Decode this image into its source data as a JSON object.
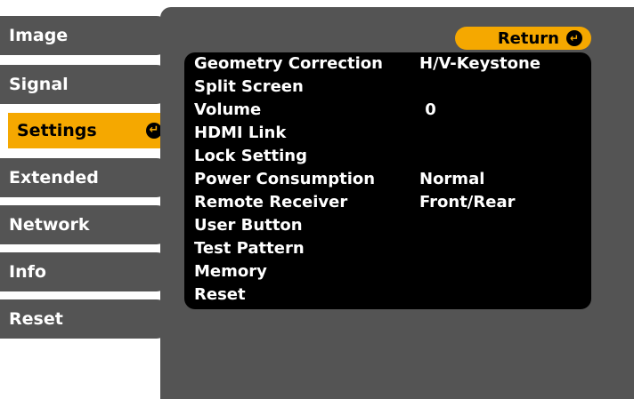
{
  "tabs": [
    {
      "label": "Image",
      "active": false
    },
    {
      "label": "Signal",
      "active": false
    },
    {
      "label": "Settings",
      "active": true
    },
    {
      "label": "Extended",
      "active": false
    },
    {
      "label": "Network",
      "active": false
    },
    {
      "label": "Info",
      "active": false
    },
    {
      "label": "Reset",
      "active": false
    }
  ],
  "active_tab_icon": "enter-icon",
  "return_button": {
    "label": "Return",
    "icon": "enter-icon"
  },
  "menu_items": [
    {
      "label": "Geometry Correction",
      "value": "H/V-Keystone"
    },
    {
      "label": "Split Screen",
      "value": ""
    },
    {
      "label": "Volume",
      "value": " 0"
    },
    {
      "label": "HDMI Link",
      "value": ""
    },
    {
      "label": "Lock Setting",
      "value": ""
    },
    {
      "label": "Power Consumption",
      "value": "Normal"
    },
    {
      "label": "Remote Receiver",
      "value": "Front/Rear"
    },
    {
      "label": "User Button",
      "value": ""
    },
    {
      "label": "Test Pattern",
      "value": ""
    },
    {
      "label": "Memory",
      "value": ""
    },
    {
      "label": "Reset",
      "value": ""
    }
  ],
  "colors": {
    "panel": "#545454",
    "accent": "#f5a800",
    "list_bg": "#000000",
    "text": "#ffffff"
  }
}
